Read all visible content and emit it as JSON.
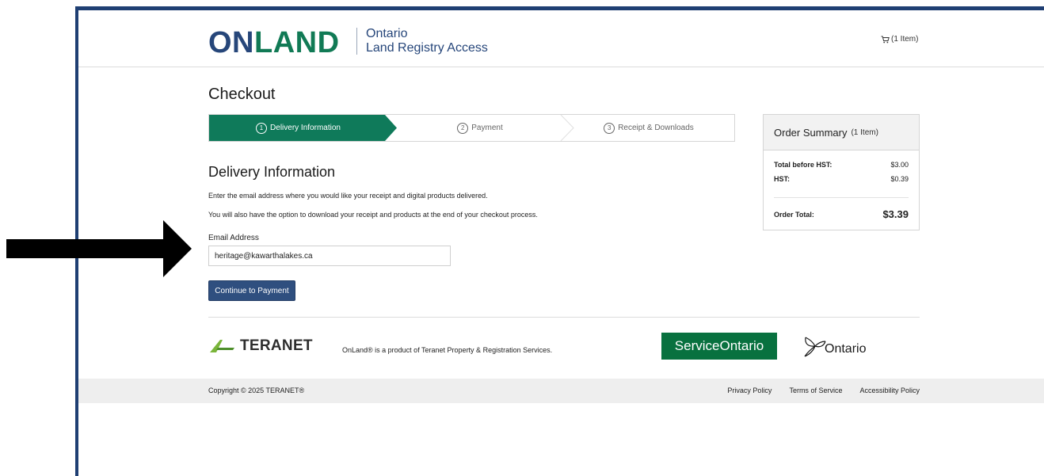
{
  "header": {
    "logo_on": "ON",
    "logo_land": "LAND",
    "subtitle_line1": "Ontario",
    "subtitle_line2": "Land Registry Access",
    "cart_label": "(1 Item)"
  },
  "checkout": {
    "title": "Checkout",
    "steps": [
      {
        "num": "1",
        "label": "Delivery Information",
        "active": true
      },
      {
        "num": "2",
        "label": "Payment",
        "active": false
      },
      {
        "num": "3",
        "label": "Receipt & Downloads",
        "active": false
      }
    ],
    "section_title": "Delivery Information",
    "info_line1": "Enter the email address where you would like your receipt and digital products delivered.",
    "info_line2": "You will also have the option to download your receipt and products at the end of your checkout process.",
    "email_label": "Email Address",
    "email_value": "heritage@kawarthalakes.ca",
    "continue_label": "Continue to Payment"
  },
  "summary": {
    "title": "Order Summary",
    "count": "(1 Item)",
    "rows": [
      {
        "label": "Total before HST:",
        "value": "$3.00"
      },
      {
        "label": "HST:",
        "value": "$0.39"
      }
    ],
    "total_label": "Order Total:",
    "total_value": "$3.39"
  },
  "footer": {
    "teranet": "TERANET",
    "product_note": "OnLand® is a product of Teranet Property & Registration Services.",
    "service_ontario": "ServiceOntario",
    "ontario": "Ontario",
    "copyright": "Copyright © 2025 TERANET®",
    "links": [
      "Privacy Policy",
      "Terms of Service",
      "Accessibility Policy"
    ]
  },
  "colors": {
    "brand_blue": "#26467a",
    "brand_green": "#117a55",
    "step_active": "#0f7a5a",
    "button": "#2f4f7f",
    "service_ontario": "#08713f"
  }
}
